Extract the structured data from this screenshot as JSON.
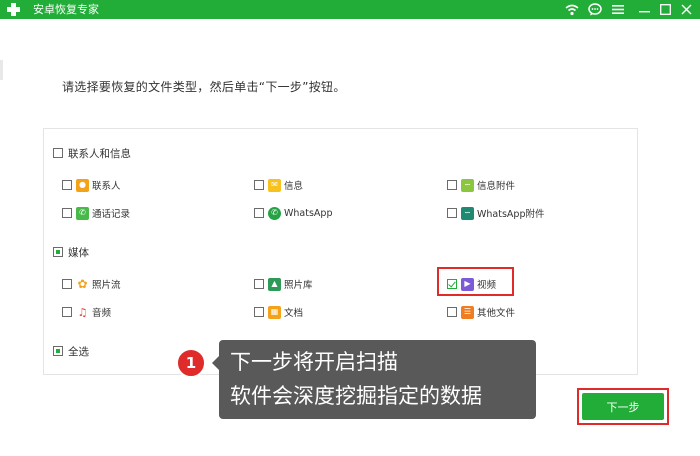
{
  "window": {
    "title": "安卓恢复专家",
    "accent_color": "#22ad38",
    "controls": [
      "wifi-icon",
      "chat-icon",
      "menu-icon",
      "minimize-icon",
      "maximize-icon",
      "close-icon"
    ]
  },
  "instruction": "请选择要恢复的文件类型，然后单击“下一步”按钮。",
  "groups": {
    "contacts": {
      "label": "联系人和信息",
      "state": "unchecked",
      "items": [
        {
          "label": "联系人",
          "icon": "contact-icon",
          "checked": false
        },
        {
          "label": "信息",
          "icon": "message-icon",
          "checked": false
        },
        {
          "label": "信息附件",
          "icon": "attachment-icon",
          "checked": false
        },
        {
          "label": "通话记录",
          "icon": "phone-icon",
          "checked": false
        },
        {
          "label": "WhatsApp",
          "icon": "whatsapp-icon",
          "checked": false
        },
        {
          "label": "WhatsApp附件",
          "icon": "whatsapp-attachment-icon",
          "checked": false
        }
      ]
    },
    "media": {
      "label": "媒体",
      "state": "partial",
      "items": [
        {
          "label": "照片流",
          "icon": "photostream-icon",
          "checked": false
        },
        {
          "label": "照片库",
          "icon": "photo-library-icon",
          "checked": false
        },
        {
          "label": "视频",
          "icon": "video-icon",
          "checked": true
        },
        {
          "label": "音频",
          "icon": "audio-icon",
          "checked": false
        },
        {
          "label": "文档",
          "icon": "document-icon",
          "checked": false
        },
        {
          "label": "其他文件",
          "icon": "other-files-icon",
          "checked": false
        }
      ]
    },
    "select_all": {
      "label": "全选",
      "state": "partial"
    }
  },
  "tooltip": {
    "step": "1",
    "line1": "下一步将开启扫描",
    "line2": "软件会深度挖掘指定的数据"
  },
  "next_button": {
    "label": "下一步"
  },
  "highlight_color": "#e02b2b"
}
